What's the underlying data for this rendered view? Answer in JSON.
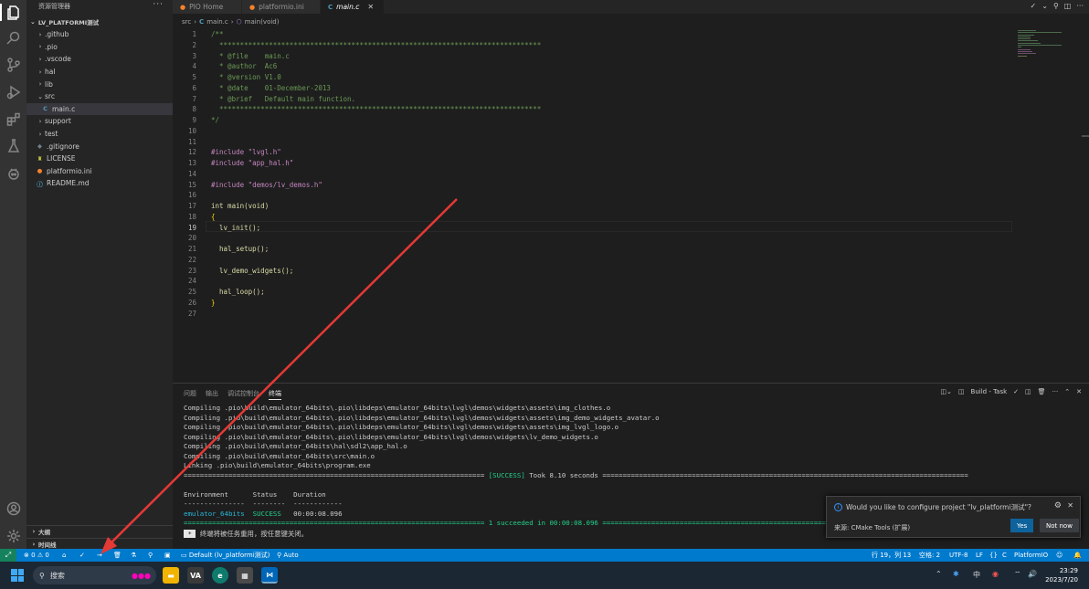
{
  "sidebar": {
    "header": "资源管理器",
    "more": "···",
    "project": "LV_PLATFORMI测试",
    "tree": [
      {
        "label": ".github",
        "type": "folder",
        "open": false
      },
      {
        "label": ".pio",
        "type": "folder",
        "open": false
      },
      {
        "label": ".vscode",
        "type": "folder",
        "open": false
      },
      {
        "label": "hal",
        "type": "folder",
        "open": false
      },
      {
        "label": "lib",
        "type": "folder",
        "open": false
      },
      {
        "label": "src",
        "type": "folder",
        "open": true
      },
      {
        "label": "main.c",
        "type": "c-file",
        "selected": true
      },
      {
        "label": "support",
        "type": "folder",
        "open": false
      },
      {
        "label": "test",
        "type": "folder",
        "open": false
      },
      {
        "label": ".gitignore",
        "type": "git-file"
      },
      {
        "label": "LICENSE",
        "type": "license-file"
      },
      {
        "label": "platformio.ini",
        "type": "pio-file"
      },
      {
        "label": "README.md",
        "type": "info-file"
      }
    ],
    "outline": "大纲",
    "timeline": "时间线"
  },
  "tabs": [
    {
      "label": "PIO Home",
      "icon": "pio-icon"
    },
    {
      "label": "platformio.ini",
      "icon": "pio-icon"
    },
    {
      "label": "main.c",
      "icon": "c-file-icon",
      "active": true
    }
  ],
  "breadcrumb": {
    "folder": "src",
    "file": "main.c",
    "symbol": "main(void)"
  },
  "editor": {
    "current_line": 19,
    "lines": [
      "/**",
      "  ******************************************************************************",
      "  * @file    main.c",
      "  * @author  Ac6",
      "  * @version V1.0",
      "  * @date    01-December-2013",
      "  * @brief   Default main function.",
      "  ******************************************************************************",
      "*/",
      "",
      "",
      "#include \"lvgl.h\"",
      "#include \"app_hal.h\"",
      "",
      "#include \"demos/lv_demos.h\"",
      "",
      "int main(void)",
      "{",
      "  lv_init();",
      "",
      "  hal_setup();",
      "",
      "  lv_demo_widgets();",
      "",
      "  hal_loop();",
      "}",
      ""
    ]
  },
  "panel": {
    "tabs": [
      "问题",
      "输出",
      "调试控制台",
      "终端"
    ],
    "active_tab": "终端",
    "task_label": "Build - Task",
    "terminal": {
      "compile_lines": [
        "Compiling .pio\\build\\emulator_64bits\\.pio\\libdeps\\emulator_64bits\\lvgl\\demos\\widgets\\assets\\img_clothes.o",
        "Compiling .pio\\build\\emulator_64bits\\.pio\\libdeps\\emulator_64bits\\lvgl\\demos\\widgets\\assets\\img_demo_widgets_avatar.o",
        "Compiling .pio\\build\\emulator_64bits\\.pio\\libdeps\\emulator_64bits\\lvgl\\demos\\widgets\\assets\\img_lvgl_logo.o",
        "Compiling .pio\\build\\emulator_64bits\\.pio\\libdeps\\emulator_64bits\\lvgl\\demos\\widgets\\lv_demo_widgets.o",
        "Compiling .pio\\build\\emulator_64bits\\hal\\sdl2\\app_hal.o",
        "Compiling .pio\\build\\emulator_64bits\\src\\main.o",
        "Linking .pio\\build\\emulator_64bits\\program.exe"
      ],
      "success_left": "==========================================================================",
      "success_tag": "[SUCCESS]",
      "success_took": " Took 8.10 seconds ",
      "success_right": "==========================================================================================",
      "table_header": "Environment      Status    Duration",
      "table_dashes": "---------------  --------  ------------",
      "env": "emulator_64bits",
      "status": "SUCCESS",
      "duration": "00:00:08.096",
      "summary_left": "==========================================================================",
      "summary": " 1 succeeded in 00:00:08.096 ",
      "summary_right": "==========================================================================================",
      "reuse_note": "终端将被任务重用，按任意键关闭。"
    }
  },
  "notification": {
    "message": "Would you like to configure project \"lv_platformi测试\"?",
    "source": "来源: CMake Tools (扩展)",
    "yes": "Yes",
    "no": "Not now"
  },
  "statusbar": {
    "errors": "0",
    "warnings": "0",
    "task": "Default (lv_platformi测试)",
    "auto": "Auto",
    "position": "行 19，列 13",
    "spaces": "空格: 2",
    "encoding": "UTF-8",
    "eol": "LF",
    "language": "C",
    "platformio": "PlatformIO"
  },
  "taskbar": {
    "search": "搜索",
    "tray_lang": "中",
    "time": "23:29",
    "date": "2023/7/20"
  },
  "colors": {
    "statusbar": "#007acc",
    "arrow": "#e53935"
  }
}
